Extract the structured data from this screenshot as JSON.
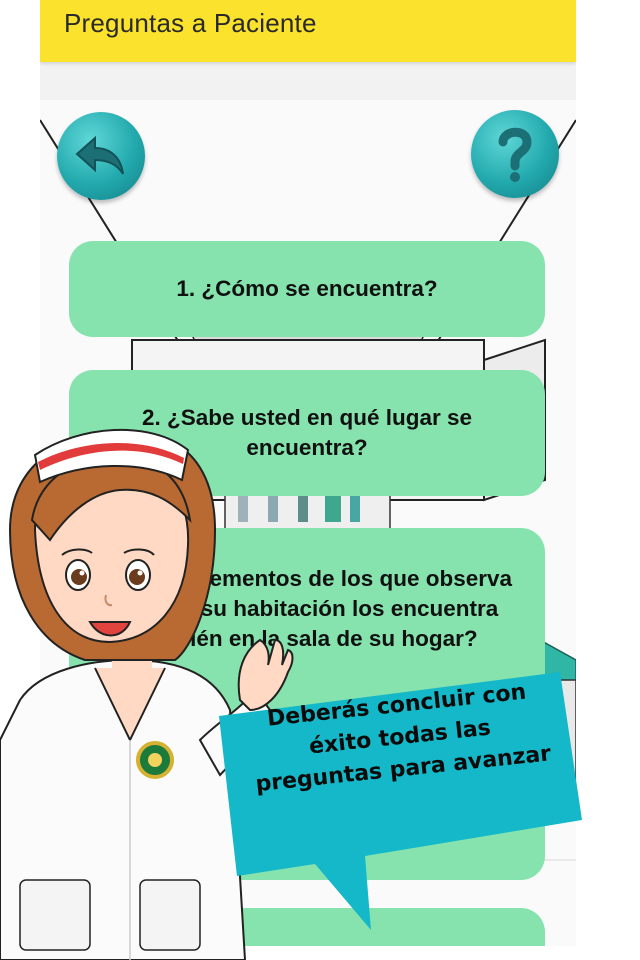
{
  "appbar": {
    "title": "Preguntas a Paciente"
  },
  "buttons": {
    "back_icon": "undo-arrow-icon",
    "help_icon": "question-mark-icon"
  },
  "questions": [
    {
      "label": "1. ¿Cómo se encuentra?"
    },
    {
      "label": "2. ¿Sabe usted en qué lugar se encuentra?"
    },
    {
      "label": "3. ¿Qué elementos de los que observa aquí en su habitación los encuentra también en la sala de su hogar?"
    }
  ],
  "speech_bubble": {
    "text": "Deberás concluir con éxito todas las preguntas para avanzar"
  },
  "colors": {
    "appbar": "#fbe22c",
    "card": "#86e3ad",
    "round_button": "#22a9ad",
    "bubble": "#14b8c8"
  }
}
